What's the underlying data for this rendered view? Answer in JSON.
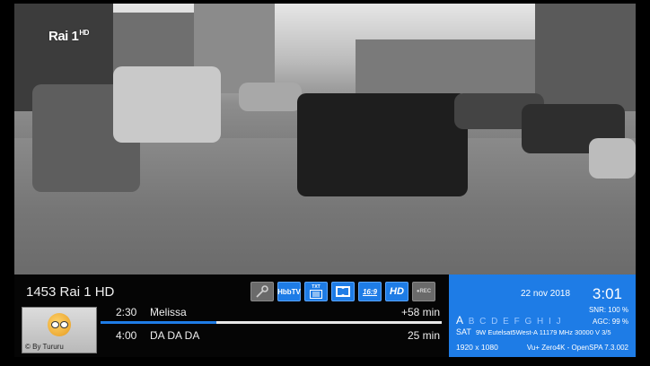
{
  "channel_logo": {
    "name": "Rai 1",
    "suffix": "HD"
  },
  "infobar": {
    "channel": "1453 Rai 1 HD",
    "icons": [
      {
        "name": "key-icon",
        "label": "",
        "active": false
      },
      {
        "name": "hbbtv-icon",
        "label": "HbbTV",
        "active": true
      },
      {
        "name": "teletext-icon",
        "label": "TXT",
        "active": true
      },
      {
        "name": "dolby-icon",
        "label": "",
        "active": true
      },
      {
        "name": "aspect-icon",
        "label": "16:9",
        "active": true
      },
      {
        "name": "hd-icon",
        "label": "HD",
        "active": true
      },
      {
        "name": "rec-icon",
        "label": "●REC",
        "active": false
      }
    ],
    "picon_brand": "© By Tururu",
    "now": {
      "time": "2:30",
      "title": "Melissa",
      "remaining": "+58 min",
      "progress": 0.34
    },
    "next": {
      "time": "4:00",
      "title": "DA DA DA",
      "duration": "25 min"
    }
  },
  "status": {
    "date": "22 nov 2018",
    "clock": "3:01",
    "snr": "SNR:  100 %",
    "agc": "AGC:  99 %",
    "letters": [
      "A",
      "B",
      "C",
      "D",
      "E",
      "F",
      "G",
      "H",
      "I",
      "J"
    ],
    "active_letter": "A",
    "sat_label": "SAT",
    "sat_info": "9W Eutelsat5West-A 11179 MHz 30000 V 3/5",
    "resolution": "1920 x 1080",
    "firmware": "Vu+ Zero4K - OpenSPA 7.3.002"
  },
  "colors": {
    "accent": "#1e7ce6",
    "bar_bg": "#050505"
  }
}
